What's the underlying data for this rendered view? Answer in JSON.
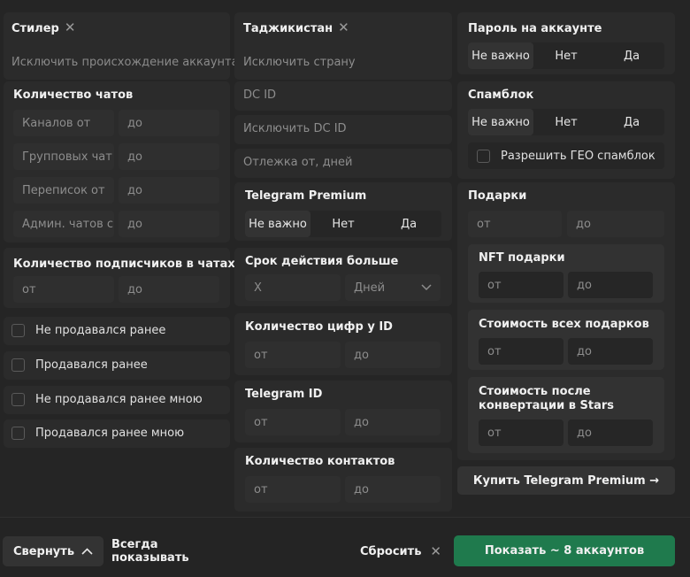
{
  "col1": {
    "stealer": "Стилер",
    "exclude_origin": "Исключить происхождение аккаунта",
    "chats_title": "Количество чатов",
    "chat_rows": [
      {
        "label": "Каналов от",
        "to": "до"
      },
      {
        "label": "Групповых чат",
        "to": "до"
      },
      {
        "label": "Переписок от",
        "to": "до"
      },
      {
        "label": "Админ. чатов с",
        "to": "до"
      }
    ],
    "subs_title": "Количество подписчиков в чатах",
    "subs_from": "от",
    "subs_to": "до",
    "checks": [
      "Не продавался ранее",
      "Продавался ранее",
      "Не продавался ранее мною",
      "Продавался ранее мною"
    ]
  },
  "col2": {
    "country": "Таджикистан",
    "exclude_country": "Исключить страну",
    "dc_id": "DC ID",
    "exclude_dc": "Исключить DC ID",
    "rest_days": "Отлежка от, дней",
    "premium_title": "Telegram Premium",
    "premium_opts": [
      "Не важно",
      "Нет",
      "Да"
    ],
    "validity_title": "Срок действия больше",
    "validity_x": "Х",
    "validity_unit": "Дней",
    "digits_title": "Количество цифр у ID",
    "digits_from": "от",
    "digits_to": "до",
    "tgid_title": "Telegram ID",
    "tgid_from": "от",
    "tgid_to": "до",
    "contacts_title": "Количество контактов",
    "contacts_from": "от",
    "contacts_to": "до"
  },
  "col3": {
    "password_title": "Пароль на аккаунте",
    "password_opts": [
      "Не важно",
      "Нет",
      "Да"
    ],
    "spam_title": "Спамблок",
    "spam_opts": [
      "Не важно",
      "Нет",
      "Да"
    ],
    "geo_spam": "Разрешить ГЕО спамблок",
    "gifts_title": "Подарки",
    "gifts_from": "от",
    "gifts_to": "до",
    "nft_title": "NFT подарки",
    "nft_from": "от",
    "nft_to": "до",
    "total_title": "Стоимость всех подарков",
    "total_from": "от",
    "total_to": "до",
    "stars_title_1": "Стоимость после",
    "stars_title_2": "конвертации в Stars",
    "stars_from": "от",
    "stars_to": "до",
    "buy_premium": "Купить Telegram Premium →"
  },
  "bottom": {
    "collapse": "Свернуть",
    "always_show": "Всегда показывать",
    "reset": "Сбросить",
    "show": "Показать ~ 8 аккаунтов"
  },
  "colors": {
    "accent": "#1f7a4d",
    "bg": "#252525",
    "panel": "#2b2b2b"
  }
}
